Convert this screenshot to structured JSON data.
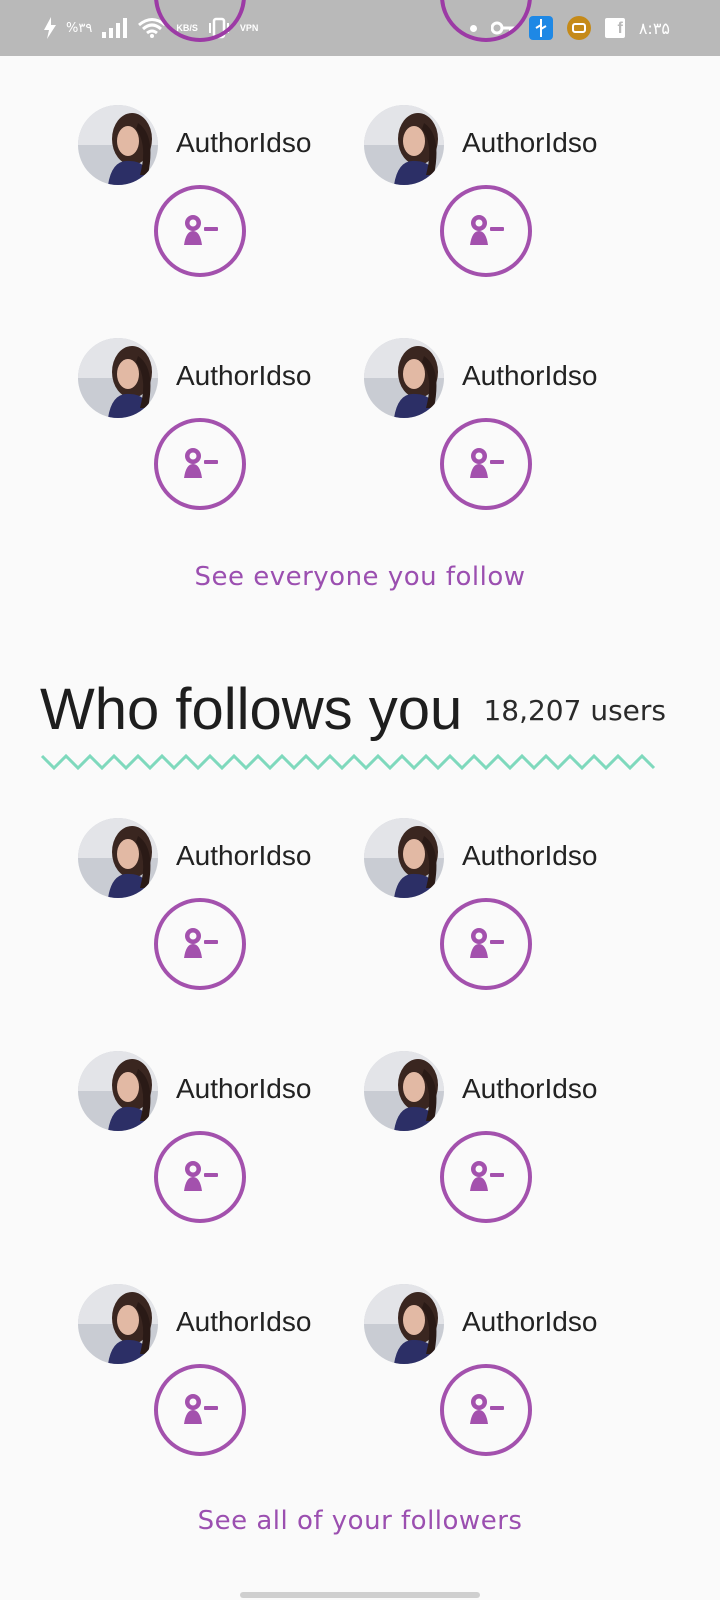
{
  "status_bar": {
    "battery_percent": "%۳۹",
    "speed_unit": "KB/S",
    "vpn_label": "VPN",
    "time": "۸:۳۵"
  },
  "following": {
    "users": [
      {
        "name": "AuthorIdso"
      },
      {
        "name": "AuthorIdso"
      },
      {
        "name": "AuthorIdso"
      },
      {
        "name": "AuthorIdso"
      }
    ],
    "see_all_label": "See everyone you follow"
  },
  "followers": {
    "title": "Who follows you",
    "count": "18,207 users",
    "users": [
      {
        "name": "AuthorIdso"
      },
      {
        "name": "AuthorIdso"
      },
      {
        "name": "AuthorIdso"
      },
      {
        "name": "AuthorIdso"
      },
      {
        "name": "AuthorIdso"
      },
      {
        "name": "AuthorIdso"
      }
    ],
    "see_all_label": "See all of your followers"
  },
  "colors": {
    "accent": "#a351ad",
    "link": "#9b4fb0",
    "zigzag": "#7fd9bd",
    "status_bar": "#b9b9b9"
  },
  "icons": {
    "unfollow": "remove-person-icon",
    "avatar": "user-photo"
  }
}
